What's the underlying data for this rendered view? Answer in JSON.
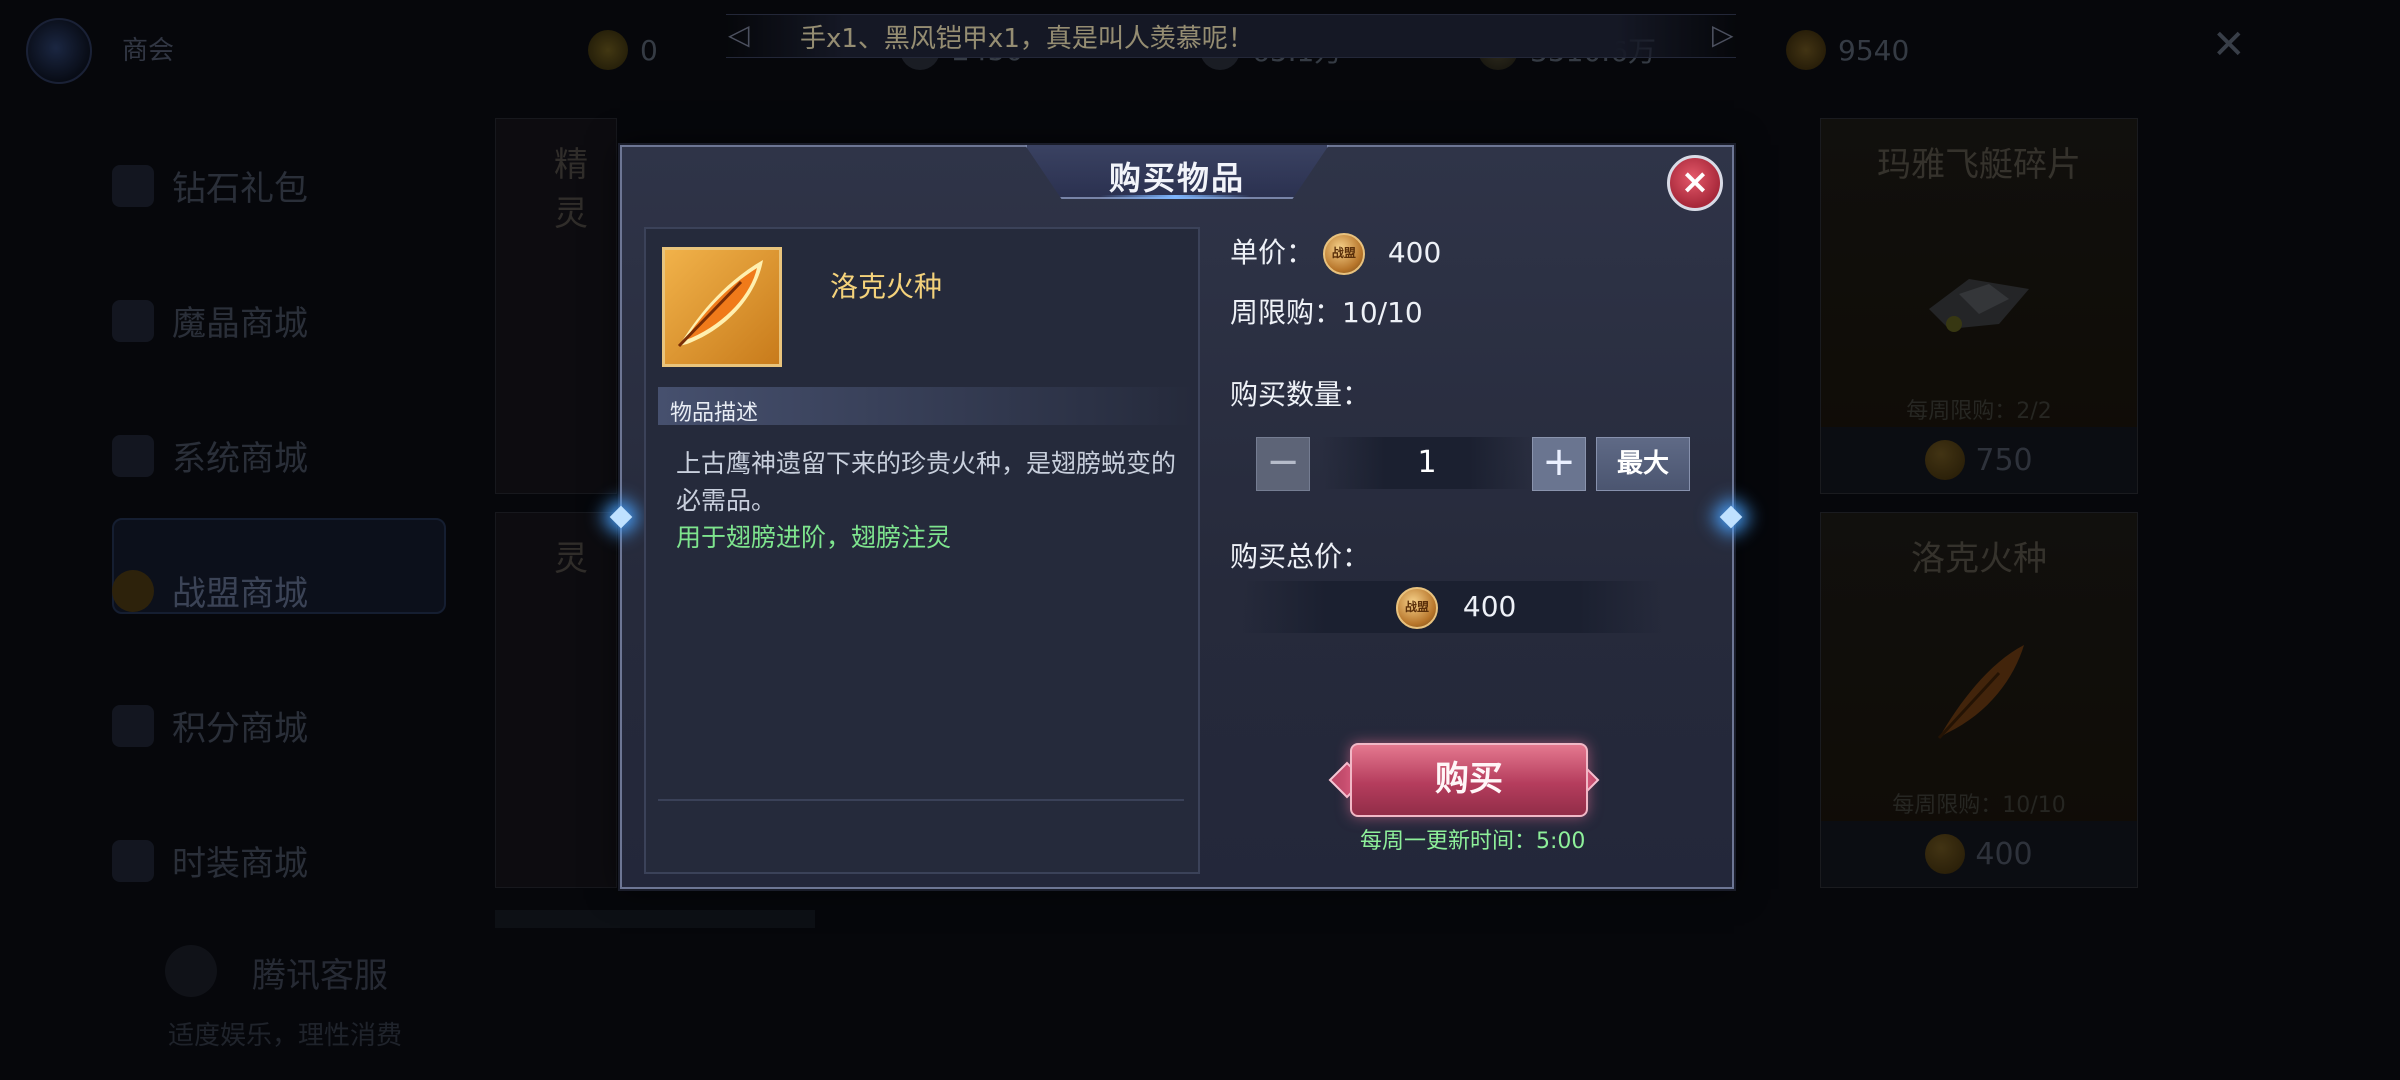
{
  "app": {
    "title": "商会"
  },
  "banner": {
    "text": "手x1、黑风铠甲x1，真是叫人羡慕呢！"
  },
  "resources": [
    {
      "icon": "diamond-icon",
      "value": "0"
    },
    {
      "icon": "diamond-plus-icon",
      "value": "2450"
    },
    {
      "icon": "gem-icon",
      "value": "65.1万"
    },
    {
      "icon": "gold-icon",
      "value": "3510.6万"
    },
    {
      "icon": "alliance-coin-icon",
      "value": "9540"
    }
  ],
  "sidebar": {
    "items": [
      {
        "label": "钻石礼包",
        "icon": "gift-icon"
      },
      {
        "label": "魔晶商城",
        "icon": "crystal-icon"
      },
      {
        "label": "系统商城",
        "icon": "gem-icon"
      },
      {
        "label": "战盟商城",
        "icon": "alliance-icon",
        "active": true
      },
      {
        "label": "积分商城",
        "icon": "sword-icon"
      },
      {
        "label": "时装商城",
        "icon": "fashion-icon"
      }
    ],
    "customer_service": {
      "label": "腾讯客服",
      "sub": "适度娱乐，理性消费"
    }
  },
  "cards": [
    {
      "name": "玛雅飞艇碎片",
      "limit": "每周限购：2/2",
      "price": "750"
    },
    {
      "name": "洛克火种",
      "limit": "每周限购：10/10",
      "price": "400"
    }
  ],
  "partial_cards": [
    {
      "name": "精灵"
    },
    {
      "name": "灵"
    }
  ],
  "modal": {
    "title": "购买物品",
    "close_label": "×",
    "item": {
      "name": "洛克火种"
    },
    "description_header": "物品描述",
    "description": "上古鹰神遗留下来的珍贵火种，是翅膀蜕变的必需品。",
    "usage": "用于翅膀进阶，翅膀注灵",
    "unit_price_label": "单价：",
    "unit_price": "400",
    "weekly_limit_label": "周限购：",
    "weekly_limit": "10/10",
    "quantity_label": "购买数量：",
    "quantity": "1",
    "minus_label": "−",
    "plus_label": "+",
    "max_label": "最大",
    "total_label": "购买总价：",
    "total": "400",
    "coin_label": "战盟",
    "buy_label": "购买",
    "refresh_label": "每周一更新时间：",
    "refresh_time": "5:00"
  },
  "colors": {
    "accent_gold": "#f4d27b",
    "accent_green": "#7ee58e",
    "buy_button": "#b53d5d"
  }
}
